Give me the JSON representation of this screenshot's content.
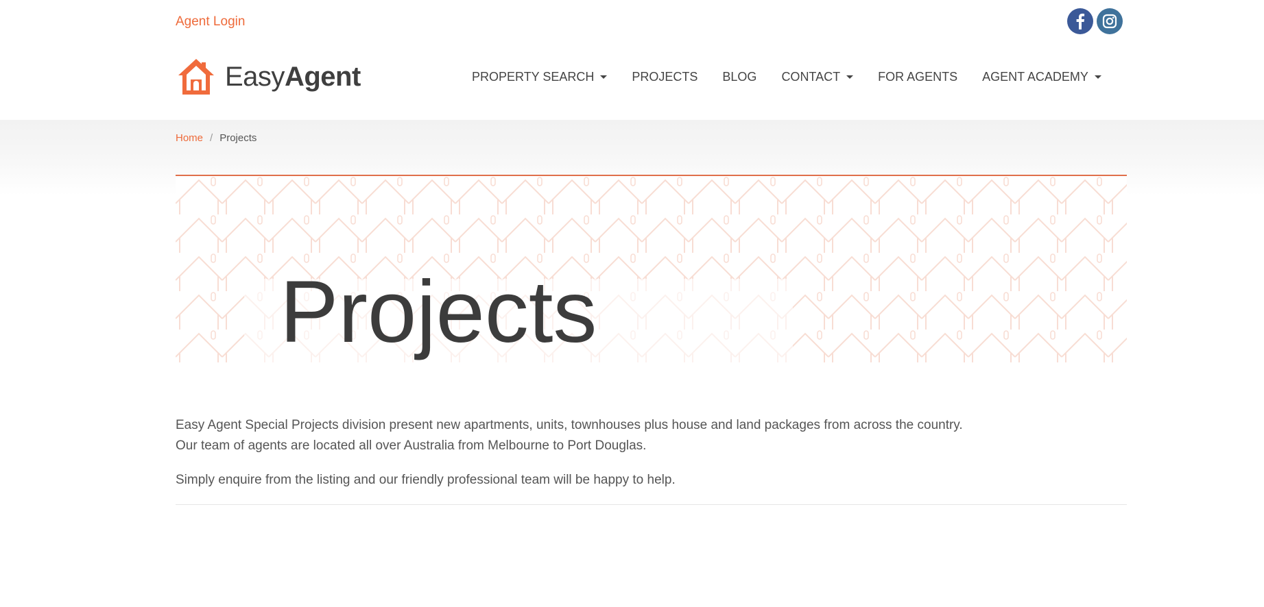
{
  "topbar": {
    "agent_login": "Agent Login",
    "social": [
      {
        "icon": "facebook-icon",
        "color": "#3b5998"
      },
      {
        "icon": "instagram-icon",
        "color": "#3f729b"
      }
    ]
  },
  "logo": {
    "easy": "Easy",
    "agent": "Agent",
    "icon": "house-icon",
    "color": "#f06b3c"
  },
  "nav": {
    "items": [
      {
        "label": "PROPERTY SEARCH",
        "dropdown": true
      },
      {
        "label": "PROJECTS",
        "dropdown": false
      },
      {
        "label": "BLOG",
        "dropdown": false
      },
      {
        "label": "CONTACT",
        "dropdown": true
      },
      {
        "label": "FOR AGENTS",
        "dropdown": false
      },
      {
        "label": "AGENT ACADEMY",
        "dropdown": true
      }
    ]
  },
  "breadcrumb": {
    "home": "Home",
    "separator": "/",
    "current": "Projects"
  },
  "banner": {
    "title": "Projects"
  },
  "content": {
    "line1": "Easy Agent Special Projects division present new apartments, units, townhouses plus house and land packages from across the country.",
    "line2": "Our team of agents are located all over Australia from Melbourne to Port Douglas.",
    "line3": "Simply enquire from the listing and our friendly professional team will be happy to help."
  },
  "colors": {
    "accent": "#ee6a3a",
    "text": "#555555"
  }
}
